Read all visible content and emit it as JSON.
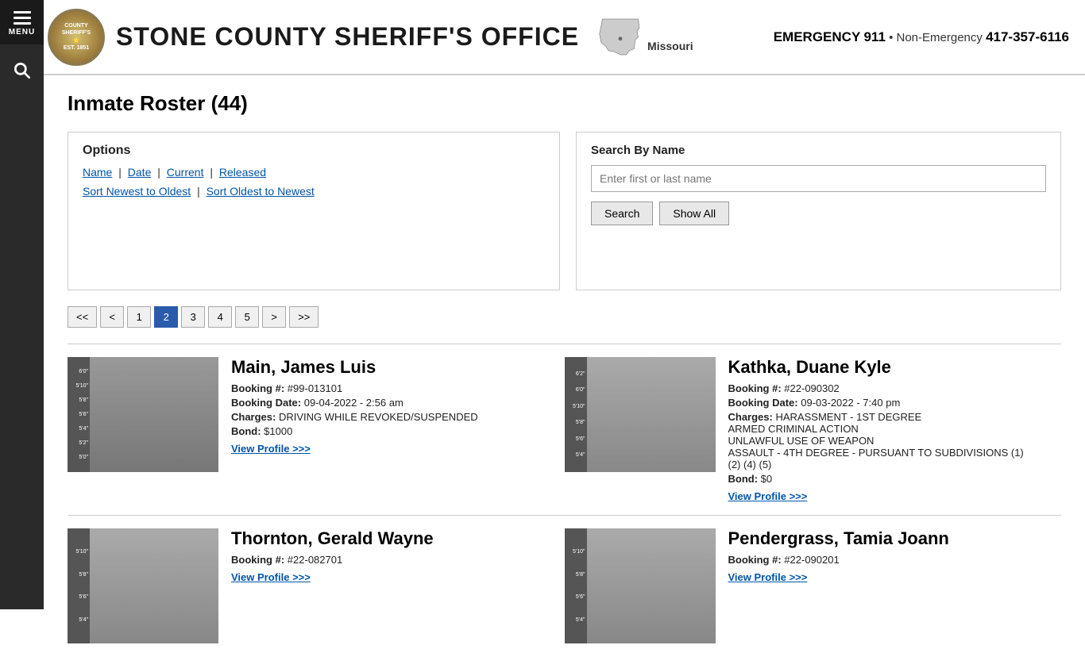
{
  "site": {
    "name": "STONE COUNTY SHERIFF'S OFFICE",
    "state": "Missouri",
    "emergency_label": "EMERGENCY",
    "emergency_number": "911",
    "non_emergency_label": "Non-Emergency",
    "non_emergency_number": "417-357-6116"
  },
  "sidebar": {
    "menu_label": "MENU",
    "search_label": "Search"
  },
  "page": {
    "title": "Inmate Roster (44)"
  },
  "options": {
    "title": "Options",
    "links": [
      {
        "label": "Name",
        "href": "#"
      },
      {
        "label": "Date",
        "href": "#"
      },
      {
        "label": "Current",
        "href": "#"
      },
      {
        "label": "Released",
        "href": "#"
      }
    ],
    "sort_links": [
      {
        "label": "Sort Newest to Oldest",
        "href": "#"
      },
      {
        "label": "Sort Oldest to Newest",
        "href": "#"
      }
    ]
  },
  "search": {
    "title": "Search By Name",
    "placeholder": "Enter first or last name",
    "search_btn": "Search",
    "show_all_btn": "Show All"
  },
  "pagination": {
    "first": "<<",
    "prev": "<",
    "pages": [
      "1",
      "2",
      "3",
      "4",
      "5"
    ],
    "active_page": "2",
    "next": ">",
    "last": ">>"
  },
  "inmates": [
    {
      "name": "Main, James Luis",
      "booking_number": "#99-013101",
      "booking_date": "09-04-2022 - 2:56 am",
      "charges": "DRIVING WHILE REVOKED/SUSPENDED",
      "bond": "$1000",
      "view_profile": "View Profile >>>"
    },
    {
      "name": "Kathka, Duane Kyle",
      "booking_number": "#22-090302",
      "booking_date": "09-03-2022 - 7:40 pm",
      "charges": "HARASSMENT - 1ST DEGREE\nARMED CRIMINAL ACTION\nUNLAWFUL USE OF WEAPON\nASSAULT - 4TH DEGREE - PURSUANT TO SUBDIVISIONS (1) (2) (4) (5)",
      "bond": "$0",
      "view_profile": "View Profile >>>"
    },
    {
      "name": "Thornton, Gerald Wayne",
      "booking_number": "#22-082701",
      "booking_date": "",
      "charges": "",
      "bond": "",
      "view_profile": "View Profile >>>"
    },
    {
      "name": "Pendergrass, Tamia Joann",
      "booking_number": "#22-090201",
      "booking_date": "",
      "charges": "",
      "bond": "",
      "view_profile": "View Profile >>>"
    }
  ],
  "labels": {
    "booking_number": "Booking #:",
    "booking_date": "Booking Date:",
    "charges": "Charges:",
    "bond": "Bond:"
  }
}
